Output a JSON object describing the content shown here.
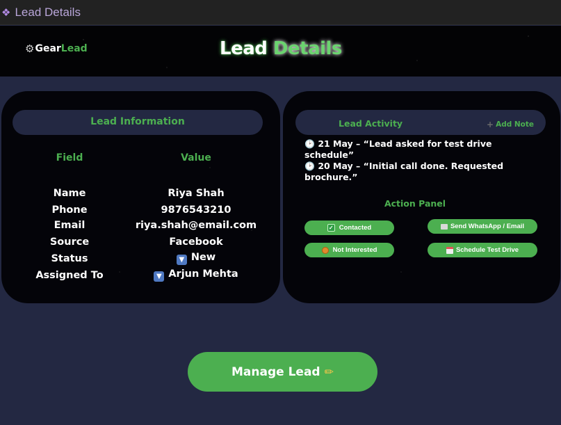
{
  "window": {
    "title": "Lead Details",
    "icon": "app-diamond-icon"
  },
  "header": {
    "logo_icon": "gear-icon",
    "logo_part1": "Gear",
    "logo_part2": "Lead",
    "title_part1": "Lead",
    "title_part2": "Details"
  },
  "lead_info": {
    "title": "Lead Information",
    "field_header": "Field",
    "value_header": "Value",
    "rows": [
      {
        "label": "Name",
        "value": "Riya Shah"
      },
      {
        "label": "Phone",
        "value": "9876543210"
      },
      {
        "label": "Email",
        "value": "riya.shah@email.com"
      },
      {
        "label": "Source",
        "value": "Facebook"
      },
      {
        "label": "Status",
        "value": "New",
        "icon": "down-arrow-box-icon"
      },
      {
        "label": "Assigned To",
        "value": "Arjun Mehta",
        "icon": "down-arrow-box-icon"
      }
    ]
  },
  "activity": {
    "title": "Lead Activity",
    "add_note": "Add Note",
    "entries": [
      {
        "icon": "clock-icon",
        "text": "21 May – “Lead asked for test drive schedule”"
      },
      {
        "icon": "clock-icon",
        "text": "20 May – “Initial call done. Requested brochure.”"
      }
    ]
  },
  "action_panel": {
    "title": "Action Panel",
    "contacted": "Contacted",
    "not_interested": "Not Interested",
    "send": "Send WhatsApp / Email",
    "schedule": "Schedule Test Drive"
  },
  "manage_button": {
    "label": "Manage Lead",
    "icon": "pencil-icon"
  },
  "colors": {
    "accent": "#4caf50",
    "background": "#232842",
    "panel": "#040409"
  }
}
